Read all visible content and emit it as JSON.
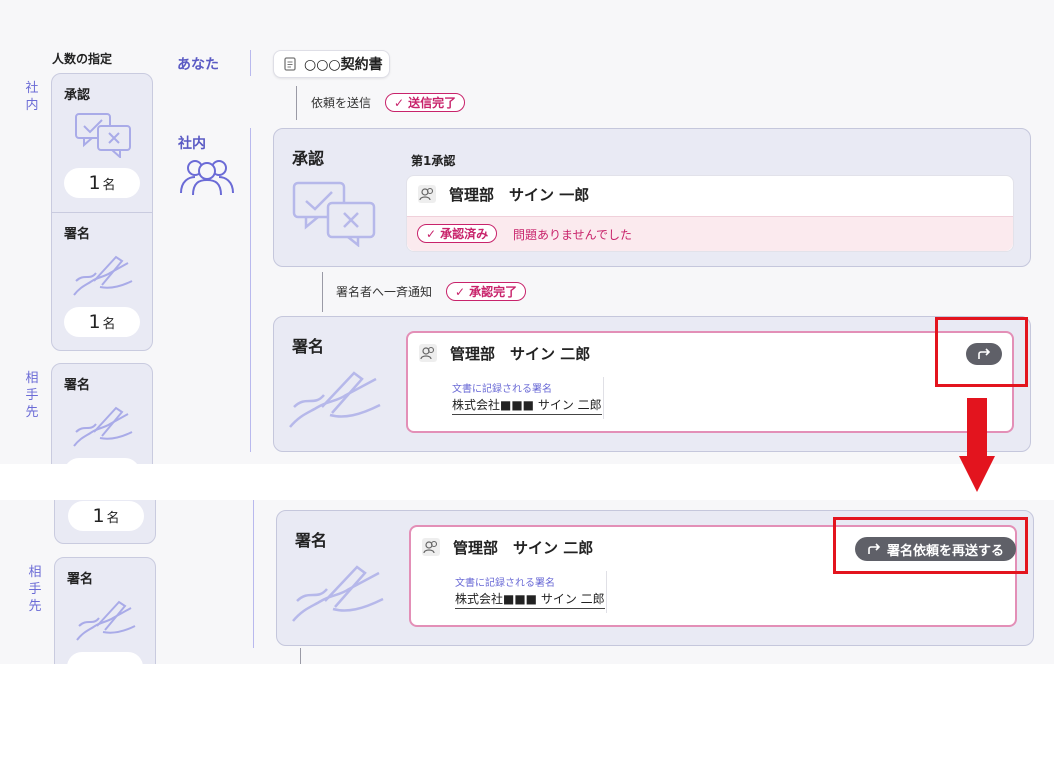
{
  "left_column": {
    "heading": "人数の指定",
    "internal_label": "社内",
    "partner_label": "相手先",
    "approve_title": "承認",
    "sign_title": "署名",
    "count": "1",
    "unit": "名"
  },
  "flow": {
    "you_label": "あなた",
    "internal_label": "社内",
    "document_name": "○○○契約書",
    "request_sent_text": "依頼を送信",
    "send_complete_pill": "送信完了",
    "notify_text": "署名者へ一斉通知",
    "approve_complete_pill": "承認完了"
  },
  "approve_stage": {
    "title": "承認",
    "subtitle": "第1承認",
    "approver_name": "管理部　サイン 一郎",
    "approved_pill": "承認済み",
    "message": "問題ありませんでした"
  },
  "sign_stage_before": {
    "title": "署名",
    "signer_name": "管理部　サイン 二郎",
    "sig_label": "文書に記録される署名",
    "sig_value": "株式会社■■■ サイン 二郎"
  },
  "sign_stage_after": {
    "title": "署名",
    "signer_name": "管理部　サイン 二郎",
    "sig_label": "文書に記録される署名",
    "sig_value": "株式会社■■■ サイン 二郎",
    "resend_label": "署名依頼を再送する"
  },
  "colors": {
    "accent_purple": "#6b6bd6",
    "complete_pink": "#c8236b",
    "annotation_red": "#e3141e",
    "stage_bg": "#e9eaf4"
  },
  "icons": {
    "doc": "document-icon",
    "person": "person-icon",
    "group": "group-icon",
    "resend": "resend-arrow-icon"
  }
}
